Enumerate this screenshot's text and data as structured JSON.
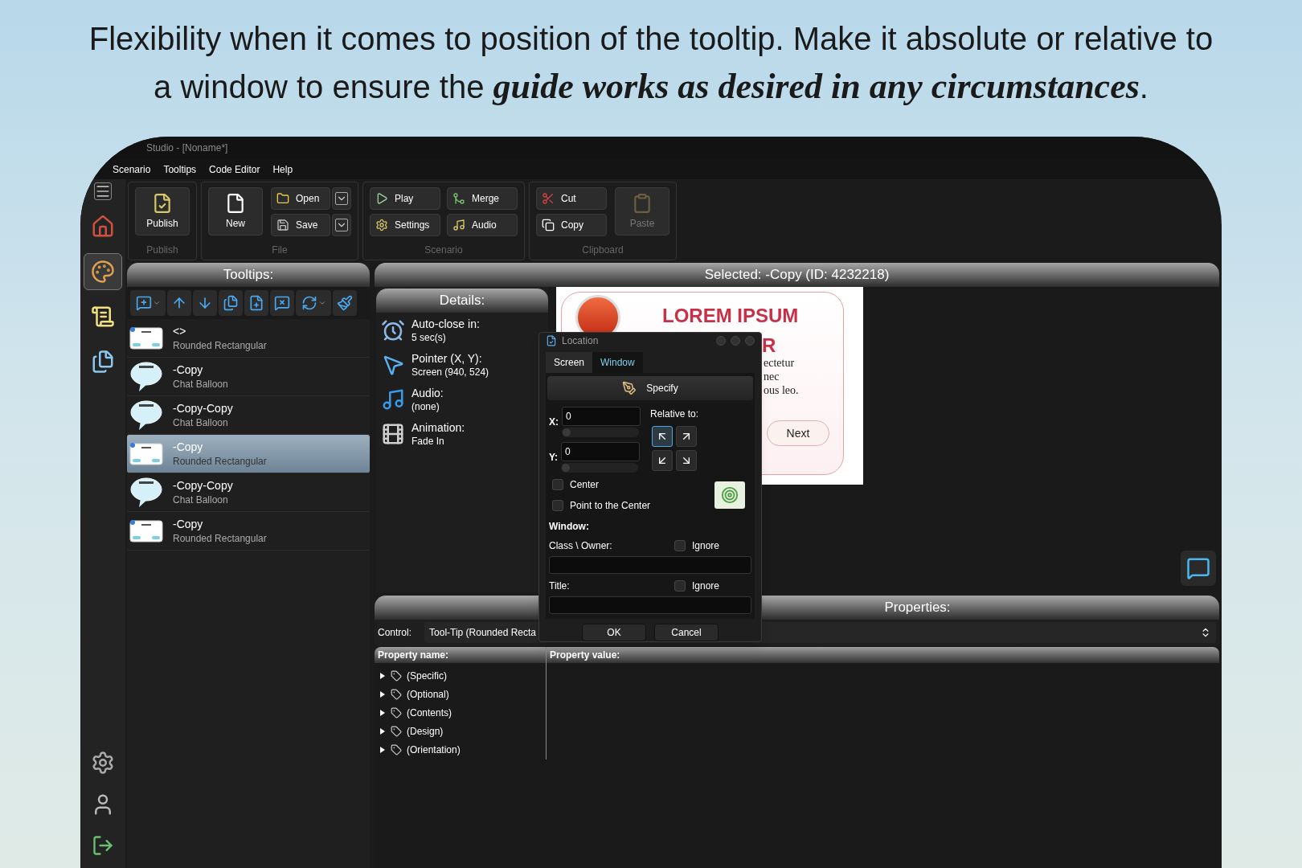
{
  "headline": "Flexibility when it comes to position of the tooltip. Make it absolute or relative to a window to ensure the **guide works as desired in any circumstances**.",
  "window": {
    "title": "Studio - [Noname*]"
  },
  "menu": [
    "Scenario",
    "Tooltips",
    "Code Editor",
    "Help"
  ],
  "side_nav": [
    {
      "selected": false
    },
    {
      "selected": true
    },
    {
      "selected": false
    },
    {
      "selected": false
    }
  ],
  "ribbon": [
    {
      "label": "Publish",
      "buttons": [
        {
          "label": "Publish",
          "kind": "large",
          "disabled": false
        }
      ]
    },
    {
      "label": "File",
      "buttons": [
        {
          "label": "New",
          "kind": "large",
          "disabled": false
        },
        {
          "label": "Open",
          "kind": "split",
          "disabled": false
        },
        {
          "label": "Save",
          "kind": "split",
          "disabled": false
        }
      ]
    },
    {
      "label": "Scenario",
      "buttons": [
        {
          "label": "Play",
          "kind": "small",
          "disabled": false
        },
        {
          "label": "Settings",
          "kind": "small",
          "disabled": false
        },
        {
          "label": "Merge",
          "kind": "small",
          "disabled": false
        },
        {
          "label": "Audio",
          "kind": "small",
          "disabled": false
        }
      ]
    },
    {
      "label": "Clipboard",
      "buttons": [
        {
          "label": "Cut",
          "kind": "small",
          "disabled": false
        },
        {
          "label": "Copy",
          "kind": "small",
          "disabled": false
        },
        {
          "label": "Paste",
          "kind": "large",
          "disabled": true
        }
      ]
    }
  ],
  "tooltips": {
    "title": "Tooltips:",
    "items": [
      {
        "name": "<>",
        "type": "Rounded Rectangular",
        "kind": "rect",
        "selected": false
      },
      {
        "name": "-Copy",
        "type": "Chat Balloon",
        "kind": "balloon",
        "selected": false
      },
      {
        "name": "-Copy-Copy",
        "type": "Chat Balloon",
        "kind": "balloon",
        "selected": false
      },
      {
        "name": "-Copy",
        "type": "Rounded Rectangular",
        "kind": "rect",
        "selected": true
      },
      {
        "name": "-Copy-Copy",
        "type": "Chat Balloon",
        "kind": "balloon",
        "selected": false
      },
      {
        "name": "-Copy",
        "type": "Rounded Rectangular",
        "kind": "rect",
        "selected": false
      }
    ]
  },
  "selected_title": "Selected: -Copy (ID: 4232218)",
  "details": {
    "title": "Details:",
    "items": [
      {
        "label": "Auto-close in:",
        "value": "5 sec(s)"
      },
      {
        "label": "Pointer (X, Y):",
        "value": "Screen (940, 524)"
      },
      {
        "label": "Audio:",
        "value": "(none)"
      },
      {
        "label": "Animation:",
        "value": "Fade In"
      }
    ]
  },
  "preview": {
    "title": "LOREM IPSUM",
    "title_rest": "R",
    "lines": [
      "ectetur",
      "nec",
      "ous leo."
    ],
    "button": "Next"
  },
  "dialog": {
    "title": "Location",
    "tabs": [
      {
        "label": "Screen",
        "selected": false
      },
      {
        "label": "Window",
        "selected": true
      }
    ],
    "specify": "Specify",
    "x_label": "X:",
    "x_value": "0",
    "x_slider": {
      "level": 0
    },
    "y_label": "Y:",
    "y_value": "0",
    "y_slider": {
      "level": 0
    },
    "relative_label": "Relative to:",
    "anchors": [
      {
        "selected": true
      },
      {
        "selected": false
      },
      {
        "selected": false
      },
      {
        "selected": false
      }
    ],
    "checks": [
      {
        "label": "Center",
        "checked": false
      },
      {
        "label": "Point to the Center",
        "checked": false
      }
    ],
    "window_label": "Window:",
    "fields": [
      {
        "label": "Class \\ Owner:",
        "ignore_label": "Ignore",
        "ignore": false
      },
      {
        "label": "Title:",
        "ignore_label": "Ignore",
        "ignore": false
      }
    ],
    "buttons": [
      "OK",
      "Cancel"
    ]
  },
  "properties": {
    "title": "Properties:",
    "control_label": "Control:",
    "control_value": "Tool-Tip (Rounded Recta",
    "columns": [
      "Property name:",
      "Property value:"
    ],
    "rows": [
      {
        "label": "(Specific)",
        "expanded": false
      },
      {
        "label": "(Optional)",
        "expanded": false
      },
      {
        "label": "(Contents)",
        "expanded": false
      },
      {
        "label": "(Design)",
        "expanded": false
      },
      {
        "label": "(Orientation)",
        "expanded": false
      }
    ]
  }
}
